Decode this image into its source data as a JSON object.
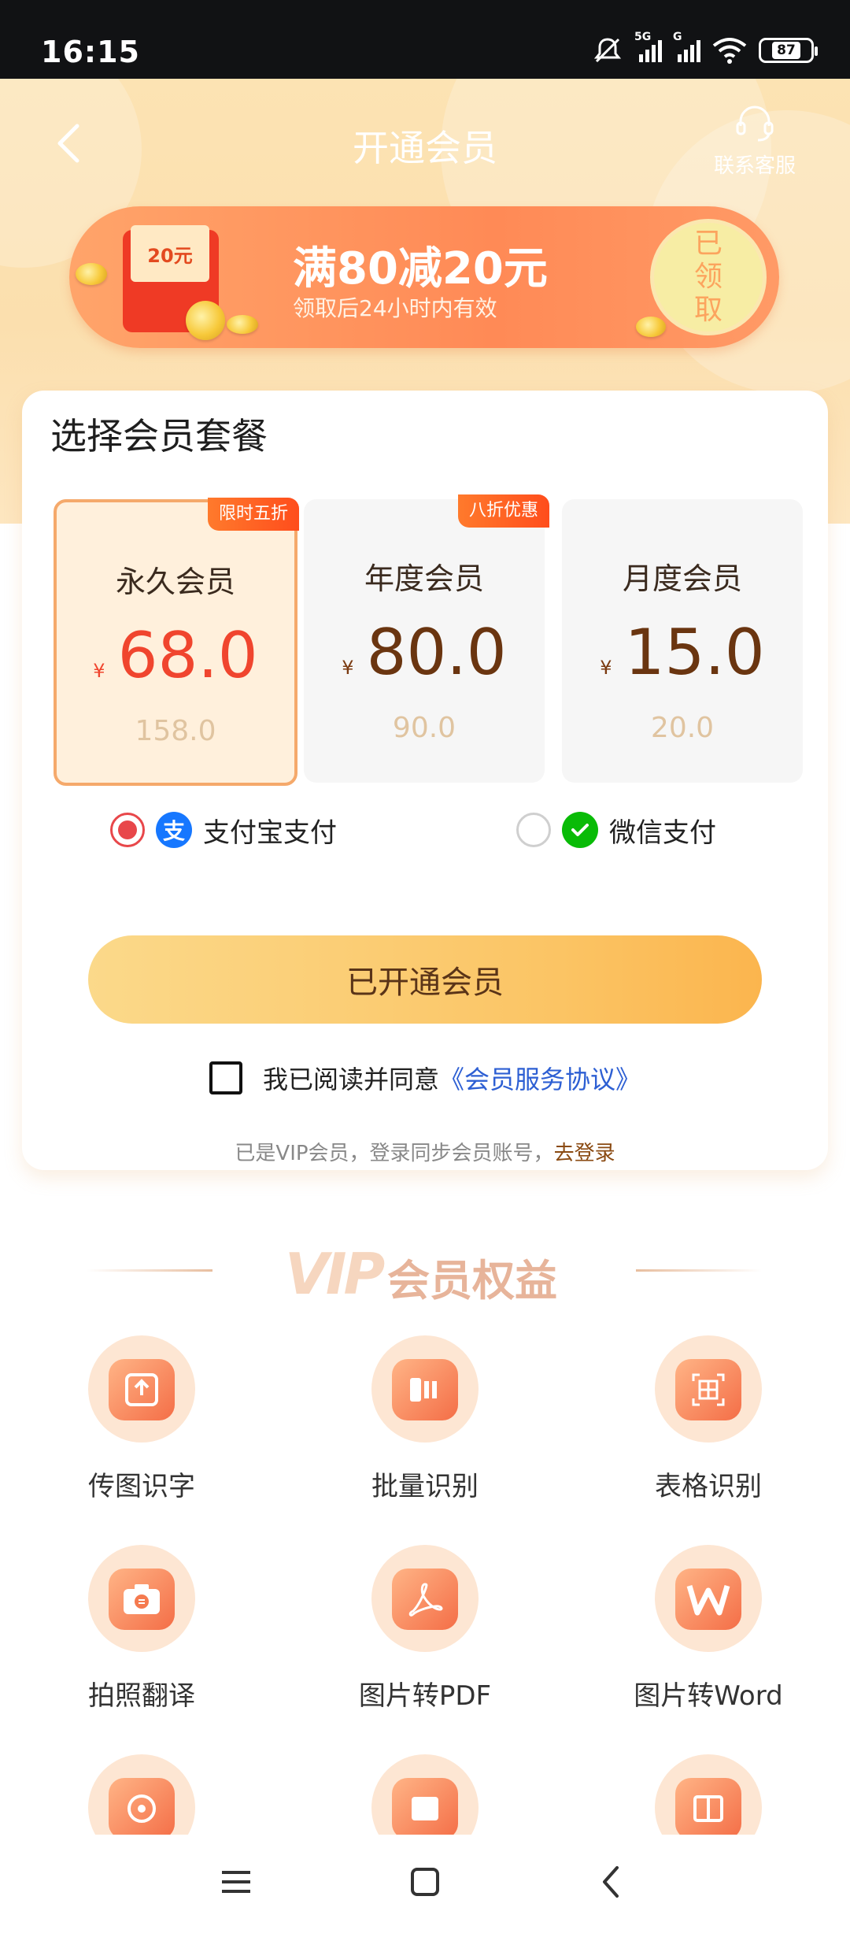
{
  "status_bar": {
    "time": "16:15",
    "network1": "5G",
    "network2": "G",
    "battery": "87"
  },
  "header": {
    "title": "开通会员",
    "service_label": "联系客服"
  },
  "coupon": {
    "envelope_text": "20元",
    "title": "满80减20元",
    "subtitle": "领取后24小时内有效",
    "status": "已领取"
  },
  "plans": {
    "heading": "选择会员套餐",
    "items": [
      {
        "name": "永久会员",
        "currency": "¥",
        "price": "68.0",
        "original": "158.0",
        "badge": "限时五折",
        "selected": true
      },
      {
        "name": "年度会员",
        "currency": "¥",
        "price": "80.0",
        "original": "90.0",
        "badge": "八折优惠",
        "selected": false
      },
      {
        "name": "月度会员",
        "currency": "¥",
        "price": "15.0",
        "original": "20.0",
        "badge": "",
        "selected": false
      }
    ]
  },
  "payment": {
    "alipay": {
      "label": "支付宝支付",
      "icon": "alipay-icon",
      "glyph": "支",
      "selected": true
    },
    "wechat": {
      "label": "微信支付",
      "icon": "wechat-icon",
      "selected": false
    }
  },
  "open_button": "已开通会员",
  "agreement": {
    "prefix": "我已阅读并同意",
    "link": "《会员服务协议》"
  },
  "vip_note": {
    "text": "已是VIP会员，登录同步会员账号，",
    "login": "去登录"
  },
  "benefits": {
    "title_vip": "VIP",
    "title": "会员权益",
    "items": [
      {
        "label": "传图识字",
        "icon": "upload-image-icon"
      },
      {
        "label": "批量识别",
        "icon": "batch-recognize-icon"
      },
      {
        "label": "表格识别",
        "icon": "table-recognize-icon"
      },
      {
        "label": "拍照翻译",
        "icon": "camera-translate-icon"
      },
      {
        "label": "图片转PDF",
        "icon": "pdf-icon"
      },
      {
        "label": "图片转Word",
        "icon": "word-icon"
      }
    ]
  },
  "colors": {
    "accent": "#f0452e",
    "gold": "#fbc464",
    "link": "#2d5fd3"
  }
}
